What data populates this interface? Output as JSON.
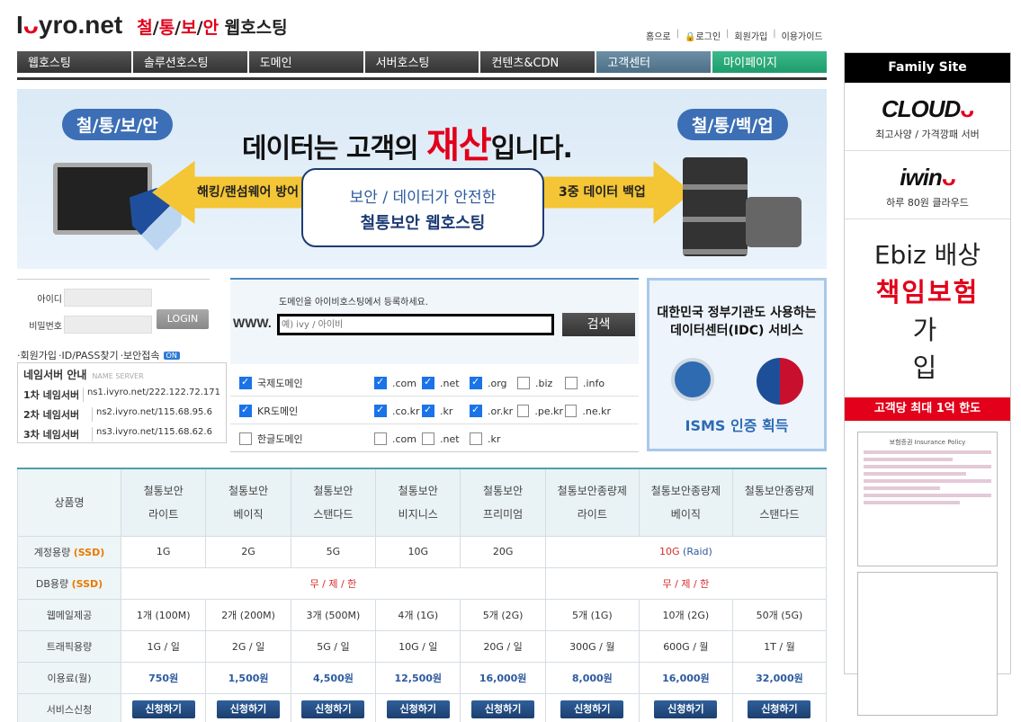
{
  "header": {
    "logo_text": "I",
    "logo_smile": "ᴗ",
    "logo_rest": "yro.net",
    "tagline_parts": [
      "철",
      "/",
      "통",
      "/",
      "보",
      "/",
      "안"
    ],
    "tagline_rest": " 웹호스팅",
    "links": [
      "홈으로",
      "로그인",
      "회원가입",
      "이용가이드"
    ]
  },
  "nav": [
    "웹호스팅",
    "솔루션호스팅",
    "도메인",
    "서버호스팅",
    "컨텐츠&CDN",
    "고객센터",
    "마이페이지"
  ],
  "banner": {
    "pill_left": "철/통/보/안",
    "pill_right": "철/통/백/업",
    "title_pre": "데이터는 고객의 ",
    "title_hl": "재산",
    "title_post": "입니다.",
    "arrow_left": "해킹/랜섬웨어 방어",
    "arrow_right": "3중 데이터 백업",
    "box_line1": "보안 / 데이터가 안전한",
    "box_line2": "철통보안 웹호스팅"
  },
  "login": {
    "id_label": "아이디",
    "pw_label": "비밀번호",
    "button": "LOGIN",
    "links": [
      "·회원가입",
      "·ID/PASS찾기",
      "·보안접속"
    ],
    "badge": "ON"
  },
  "nameserver": {
    "title": "네임서버 안내",
    "subtitle": "NAME SERVER",
    "rows": [
      {
        "label": "1차 네임서버",
        "value": "ns1.ivyro.net/222.122.72.171"
      },
      {
        "label": "2차 네임서버",
        "value": "ns2.ivyro.net/115.68.95.6"
      },
      {
        "label": "3차 네임서버",
        "value": "ns3.ivyro.net/115.68.62.6"
      }
    ]
  },
  "domain": {
    "hint": "도메인을 아이비호스팅에서 등록하세요.",
    "www": "WWW.",
    "placeholder": "예) ivy / 아이비",
    "button": "검색",
    "groups": [
      {
        "label": "국제도메인",
        "checked": true,
        "opts": [
          {
            "t": ".com",
            "c": true
          },
          {
            "t": ".net",
            "c": true
          },
          {
            "t": ".org",
            "c": true
          },
          {
            "t": ".biz",
            "c": false
          },
          {
            "t": ".info",
            "c": false
          }
        ]
      },
      {
        "label": "KR도메인",
        "checked": true,
        "opts": [
          {
            "t": ".co.kr",
            "c": true
          },
          {
            "t": ".kr",
            "c": true
          },
          {
            "t": ".or.kr",
            "c": true
          },
          {
            "t": ".pe.kr",
            "c": false
          },
          {
            "t": ".ne.kr",
            "c": false
          }
        ]
      },
      {
        "label": "한글도메인",
        "checked": false,
        "opts": [
          {
            "t": ".com",
            "c": false
          },
          {
            "t": ".net",
            "c": false
          },
          {
            "t": ".kr",
            "c": false
          }
        ]
      }
    ]
  },
  "isms": {
    "line1": "대한민국 정부기관도 사용하는",
    "line2": "데이터센터(IDC) 서비스",
    "bottom": "ISMS 인증 획득"
  },
  "table": {
    "head_label": "상품명",
    "products": [
      [
        "철통보안",
        "라이트"
      ],
      [
        "철통보안",
        "베이직"
      ],
      [
        "철통보안",
        "스탠다드"
      ],
      [
        "철통보안",
        "비지니스"
      ],
      [
        "철통보안",
        "프리미엄"
      ],
      [
        "철통보안종량제",
        "라이트"
      ],
      [
        "철통보안종량제",
        "베이직"
      ],
      [
        "철통보안종량제",
        "스탠다드"
      ]
    ],
    "storage_label": "계정용량",
    "ssd": "(SSD)",
    "storage": [
      "1G",
      "2G",
      "5G",
      "10G",
      "20G"
    ],
    "storage_metered": "10G",
    "raid": "(Raid)",
    "db_label": "DB용량",
    "unlimited": "무 / 제 / 한",
    "mail_label": "웹메일제공",
    "mail": [
      "1개 (100M)",
      "2개 (200M)",
      "3개 (500M)",
      "4개 (1G)",
      "5개 (2G)",
      "5개 (1G)",
      "10개 (2G)",
      "50개 (5G)"
    ],
    "traffic_label": "트래픽용량",
    "traffic": [
      "1G / 일",
      "2G / 일",
      "5G / 일",
      "10G / 일",
      "20G / 일",
      "300G / 월",
      "600G / 월",
      "1T / 월"
    ],
    "price_label": "이용료(월)",
    "price": [
      "750원",
      "1,500원",
      "4,500원",
      "12,500원",
      "16,000원",
      "8,000원",
      "16,000원",
      "32,000원"
    ],
    "apply_label": "서비스신청",
    "apply_button": "신청하기"
  },
  "sidebar": {
    "title": "Family Site",
    "cloud_brand": "CLOUD",
    "cloud_sub": "최고사양 / 가격깡패 서버",
    "iwin_brand": "iwin",
    "iwin_sub": "하루 80원 클라우드",
    "ebiz_1": "Ebiz 배상",
    "ebiz_2": "책임보험",
    "ebiz_3": "가입",
    "red_bar": "고객당 최대 1억 한도",
    "doc_title": "보험증권 Insurance Policy"
  }
}
